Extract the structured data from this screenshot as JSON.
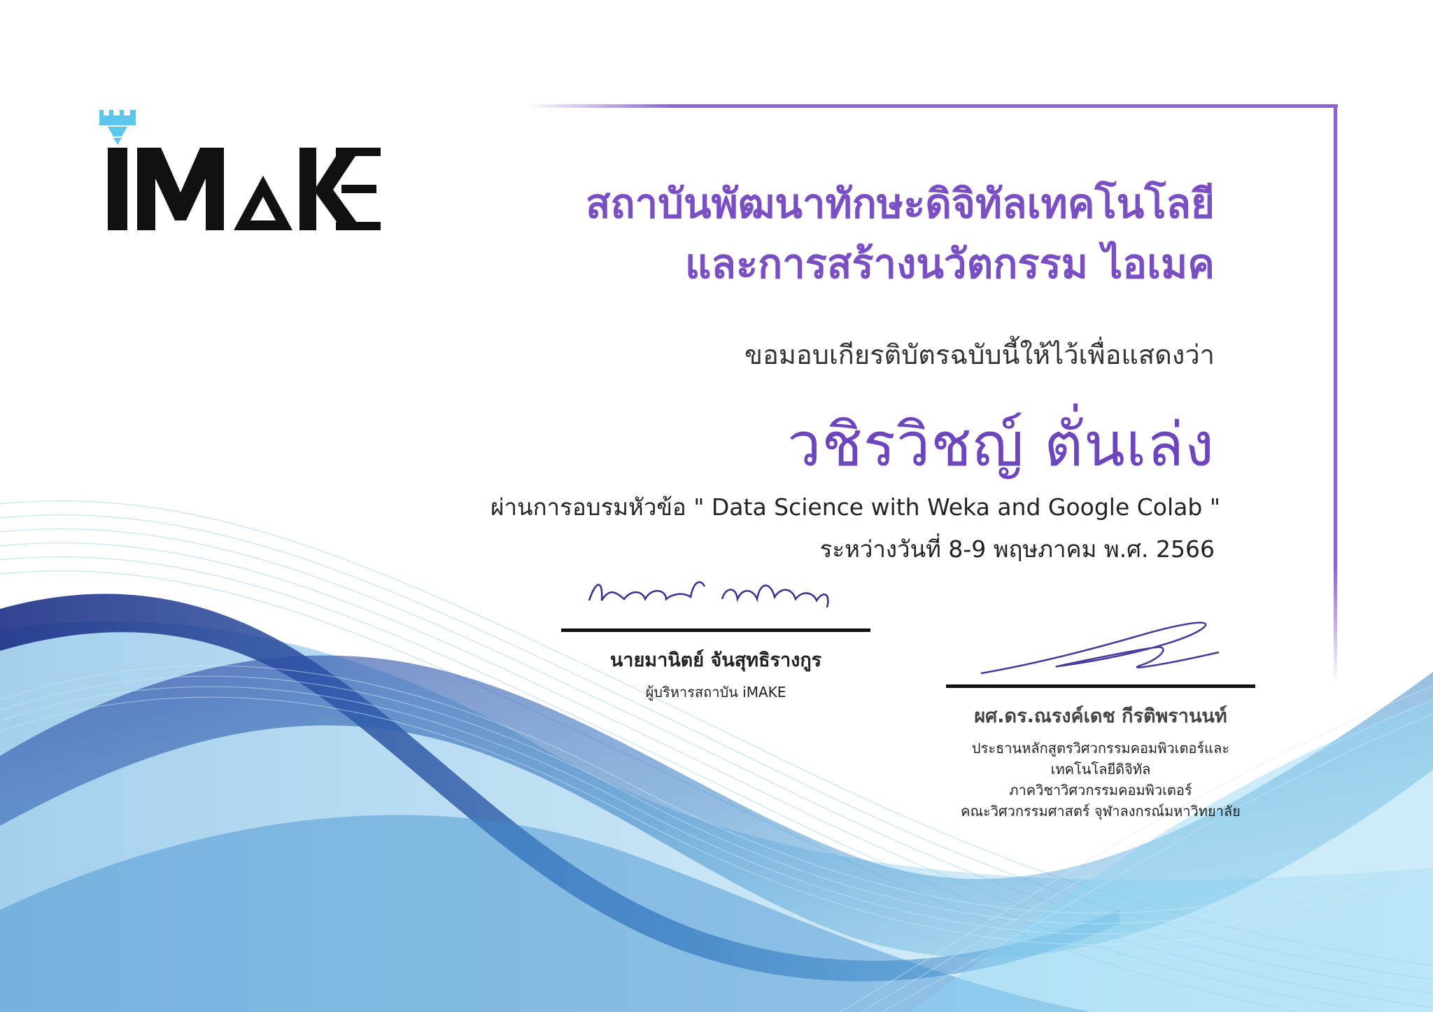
{
  "logo": {
    "text": "iMAKE",
    "icon": "castle-nozzle-icon",
    "accent": "#5bc6ec"
  },
  "institute": {
    "line1": "สถาบันพัฒนาทักษะดิจิทัลเทคโนโลยี",
    "line2": "และการสร้างนวัตกรรม ไอเมค"
  },
  "certificate": {
    "presented_text": "ขอมอบเกียรติบัตรฉบับนี้ให้ไว้เพื่อแสดงว่า",
    "recipient": "วชิรวิชญ์  ตั่นเล่ง",
    "course_line": "ผ่านการอบรมหัวข้อ \" Data Science with Weka and Google Colab \"",
    "date_line": "ระหว่างวันที่ 8-9 พฤษภาคม พ.ศ. 2566"
  },
  "signatories": [
    {
      "name": "นายมานิตย์ จันสุทธิรางกูร",
      "title_lines": [
        "ผู้บริหารสถาบัน iMAKE"
      ]
    },
    {
      "name": "ผศ.ดร.ณรงค์เดช กีรติพรานนท์",
      "title_lines": [
        "ประธานหลักสูตรวิศวกรรมคอมพิวเตอร์และเทคโนโลยีดิจิทัล",
        "ภาควิชาวิศวกรรมคอมพิวเตอร์",
        "คณะวิศวกรรมศาสตร์ จุฬาลงกรณ์มหาวิทยาลัย"
      ]
    }
  ],
  "colors": {
    "accent": "#7a4fc4",
    "frame": "#8a63cf",
    "wave_dark": "#1b3f8f",
    "wave_light": "#6ec3ea"
  }
}
